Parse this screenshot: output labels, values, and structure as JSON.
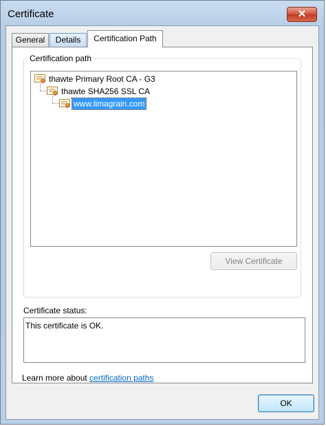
{
  "window": {
    "title": "Certificate",
    "close_label": "✕"
  },
  "tabs": [
    {
      "label": "General"
    },
    {
      "label": "Details"
    },
    {
      "label": "Certification Path"
    }
  ],
  "path_group": {
    "label": "Certification path",
    "tree": [
      {
        "label": "thawte Primary Root CA - G3",
        "level": 0,
        "selected": false
      },
      {
        "label": "thawte SHA256 SSL CA",
        "level": 1,
        "selected": false
      },
      {
        "label": "www.limagrain.com",
        "level": 2,
        "selected": true
      }
    ],
    "view_button": "View Certificate"
  },
  "status": {
    "label": "Certificate status:",
    "text": "This certificate is OK."
  },
  "learn_more": {
    "prefix": "Learn more about ",
    "link": "certification paths"
  },
  "footer": {
    "ok_label": "OK"
  },
  "colors": {
    "selection": "#3399ff",
    "link": "#0066cc",
    "close": "#c13a22"
  }
}
